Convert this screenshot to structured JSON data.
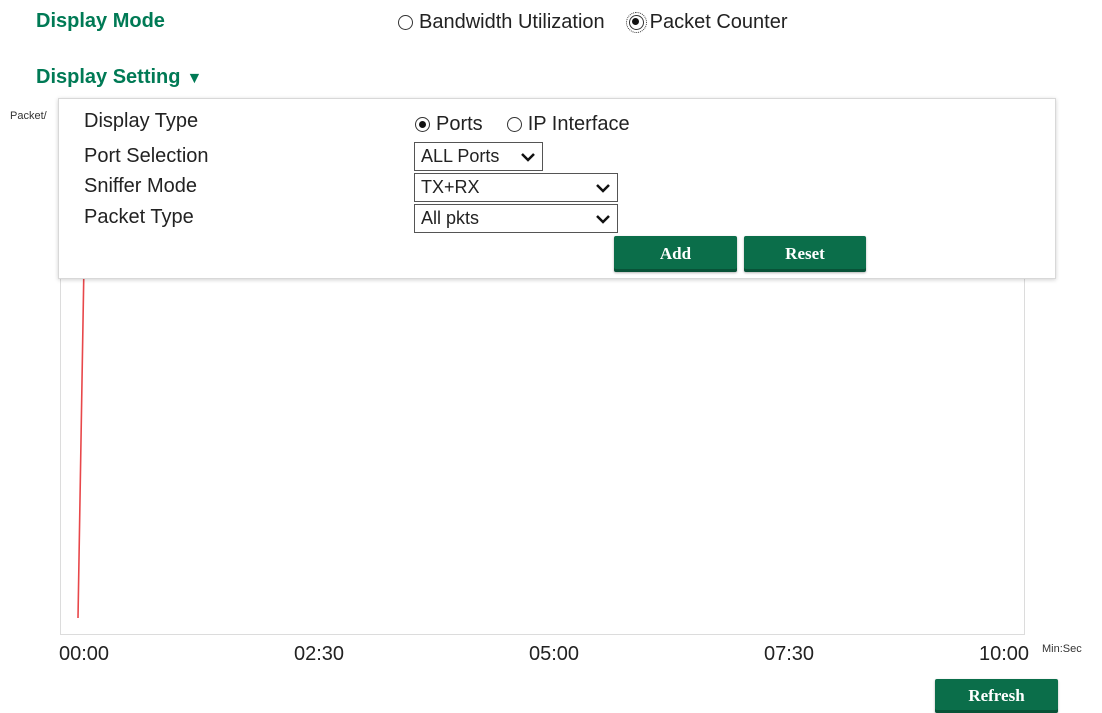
{
  "display_mode": {
    "label": "Display Mode",
    "options": [
      {
        "label": "Bandwidth Utilization",
        "checked": false
      },
      {
        "label": "Packet Counter",
        "checked": true
      }
    ]
  },
  "display_setting": {
    "label": "Display Setting",
    "toggle_icon": "triangle-down-icon",
    "display_type": {
      "label": "Display Type",
      "options": [
        {
          "label": "Ports",
          "checked": true
        },
        {
          "label": "IP Interface",
          "checked": false
        }
      ]
    },
    "port_selection": {
      "label": "Port Selection",
      "value": "ALL Ports"
    },
    "sniffer_mode": {
      "label": "Sniffer Mode",
      "value": "TX+RX"
    },
    "packet_type": {
      "label": "Packet Type",
      "value": "All pkts"
    },
    "add_label": "Add",
    "reset_label": "Reset"
  },
  "chart_data": {
    "type": "line",
    "ylabel": "Packet/",
    "xlabel": "Min:Sec",
    "x_ticks": [
      "00:00",
      "02:30",
      "05:00",
      "07:30",
      "10:00"
    ],
    "series": [
      {
        "color": "#e8474a",
        "points": [
          {
            "x": "00:00",
            "y": 0
          },
          {
            "x": "00:05",
            "y": 0.88
          },
          {
            "x": "00:08",
            "y": 0.86
          },
          {
            "x": "00:11",
            "y": 0.94
          }
        ]
      }
    ]
  },
  "refresh_label": "Refresh",
  "colors": {
    "accent": "#007a55",
    "button": "#0b6e4a",
    "line": "#e8474a"
  }
}
